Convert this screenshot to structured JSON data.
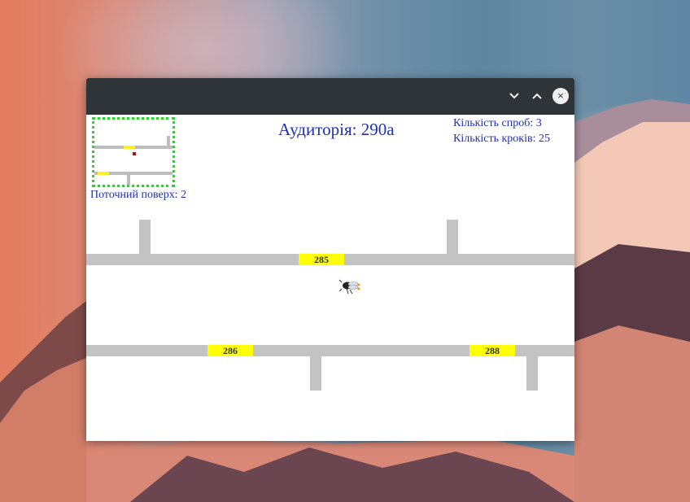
{
  "window": {
    "controls": {
      "minimize_icon": "chevron-down-icon",
      "maximize_icon": "chevron-up-icon",
      "close_glyph": "×"
    }
  },
  "hud": {
    "room_title": "Аудиторія: 290а",
    "attempts": "Кількість спроб: 3",
    "steps": "Кількість кроків: 25",
    "current_floor": "Поточний поверх: 2"
  },
  "doors": {
    "top": [
      "285"
    ],
    "bottom": [
      "286",
      "288"
    ]
  },
  "colors": {
    "text": "#1e2fb5",
    "wall": "#c3c3c3",
    "door": "#ffff00",
    "minimap_border": "#2bd32b",
    "titlebar": "#2f3438"
  }
}
